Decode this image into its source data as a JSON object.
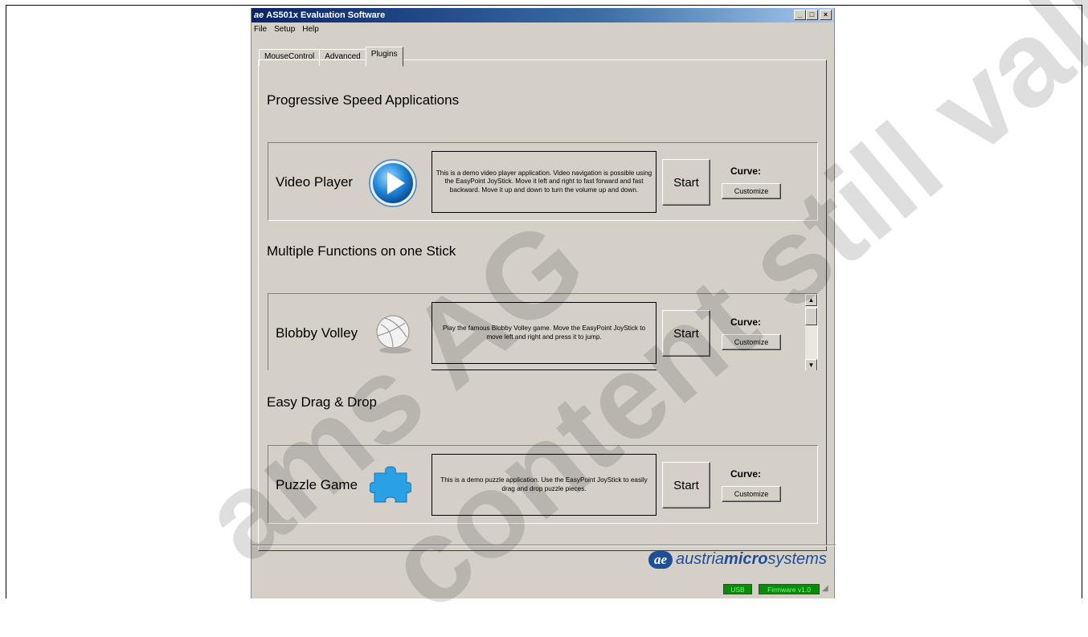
{
  "window": {
    "title": "AS501x Evaluation Software",
    "logo_text": "ae",
    "controls": {
      "minimize": "_",
      "maximize": "□",
      "close": "×"
    }
  },
  "menu": [
    {
      "label": "File"
    },
    {
      "label": "Setup"
    },
    {
      "label": "Help"
    }
  ],
  "tabs": [
    {
      "label": "MouseControl",
      "active": false
    },
    {
      "label": "Advanced",
      "active": false
    },
    {
      "label": "Plugins",
      "active": true
    }
  ],
  "sections": [
    {
      "heading": "Progressive Speed Applications",
      "app_name": "Video Player",
      "icon": "play-icon",
      "description": "This is a demo video player application.      Video navigation is possible using the EasyPoint JoyStick. Move it left and right to fast forward and fast backward. Move it up and down to turn the volume up and down.",
      "start_label": "Start",
      "curve_label": "Curve:",
      "customize_label": "Customize"
    },
    {
      "heading": "Multiple Functions on one Stick",
      "app_name": "Blobby Volley",
      "icon": "volleyball-icon",
      "description": "Play the famous Blobby Volley game. Move the EasyPoint JoyStick to move left and right and press it to jump.",
      "start_label": "Start",
      "curve_label": "Curve:",
      "customize_label": "Customize"
    },
    {
      "heading": "Easy Drag & Drop",
      "app_name": "Puzzle Game",
      "icon": "puzzle-icon",
      "description": "This is a demo puzzle application.      Use the EasyPoint JoyStick to easily drag and drop puzzle pieces.",
      "start_label": "Start",
      "curve_label": "Curve:",
      "customize_label": "Customize"
    }
  ],
  "footer": {
    "brand_logo": "ae",
    "brand_prefix": "austria",
    "brand_bold": "micro",
    "brand_suffix": "systems",
    "usb_status": "USB",
    "firmware_status": "Firmware v1.0"
  },
  "watermark": {
    "line1": "ams AG",
    "line2": "content still valid"
  },
  "colors": {
    "brand_blue": "#1f4e99",
    "status_green": "#0a8c0a",
    "window_bg": "#d4d0c8"
  }
}
